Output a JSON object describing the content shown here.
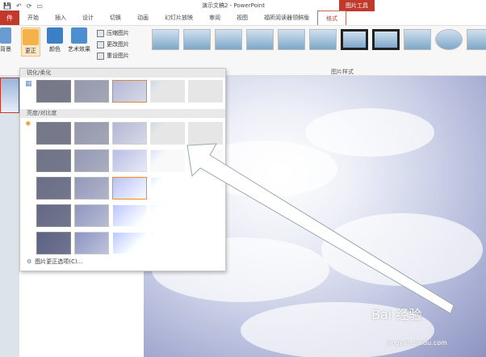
{
  "title": "演示文稿2 - PowerPoint",
  "tool_tab": "图片工具",
  "file_tab": "件",
  "tabs": [
    "开始",
    "插入",
    "设计",
    "切换",
    "动画",
    "幻灯片放映",
    "审阅",
    "视图",
    "福昕阅读器领鲜版",
    "格式"
  ],
  "ribbon": {
    "left_label": "背景",
    "corrections": "更正",
    "color": "颜色",
    "artistic": "艺术效果",
    "compress": "压缩图片",
    "change": "更改图片",
    "reset": "重设图片",
    "styles_group": "图片样式"
  },
  "panel": {
    "sharpen_header": "锐化/柔化",
    "brightness_header": "亮度/对比度",
    "footer": "图片更正选项(C)..."
  },
  "watermark": {
    "brand": "Bai 经验",
    "url": "jingyan.baidu.com"
  },
  "colors": {
    "accent": "#c0392b",
    "selection": "#e67e22"
  }
}
